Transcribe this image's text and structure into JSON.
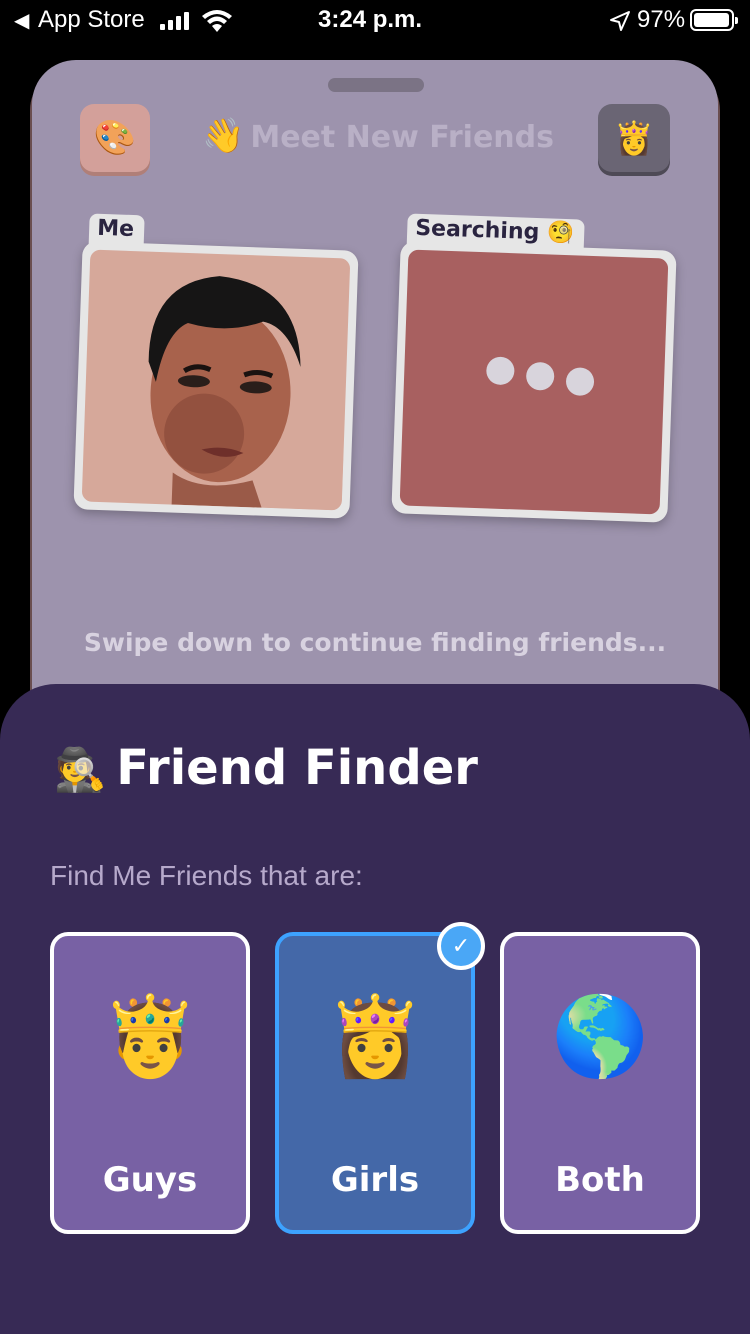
{
  "status_bar": {
    "back_label": "App Store",
    "time": "3:24 p.m.",
    "battery": "97%",
    "battery_level": 0.97
  },
  "card": {
    "title": "Meet New Friends",
    "title_emoji": "👋",
    "palette_emoji": "🎨",
    "crown_emoji": "👸",
    "me_label": "Me",
    "searching_label": "Searching 🧐",
    "swipe_hint": "Swipe down to continue finding friends..."
  },
  "sheet": {
    "title": "Friend Finder",
    "title_emoji": "🕵️",
    "subtitle": "Find Me Friends that are:",
    "options": [
      {
        "label": "Guys",
        "emoji": "🤴",
        "selected": false
      },
      {
        "label": "Girls",
        "emoji": "👸",
        "selected": true
      },
      {
        "label": "Both",
        "emoji": "🌎",
        "selected": false
      }
    ]
  },
  "colors": {
    "sheet_bg": "#372a55",
    "option_bg": "#7861a4",
    "selected_bg": "#4468a8",
    "selected_border": "#3da2ff",
    "card_bg": "#9d93ad"
  }
}
